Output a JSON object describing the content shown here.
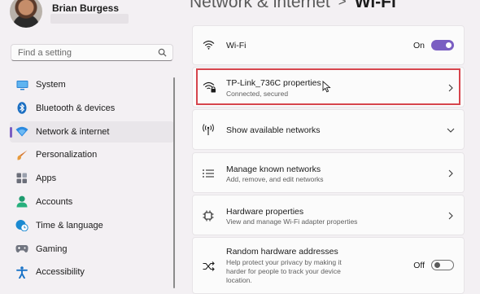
{
  "user": {
    "name": "Brian Burgess"
  },
  "search": {
    "placeholder": "Find a setting"
  },
  "sidebar": {
    "items": [
      {
        "label": "System",
        "icon": "monitor-icon"
      },
      {
        "label": "Bluetooth & devices",
        "icon": "bluetooth-icon"
      },
      {
        "label": "Network & internet",
        "icon": "wifi-icon",
        "active": true
      },
      {
        "label": "Personalization",
        "icon": "paintbrush-icon"
      },
      {
        "label": "Apps",
        "icon": "apps-icon"
      },
      {
        "label": "Accounts",
        "icon": "person-icon"
      },
      {
        "label": "Time & language",
        "icon": "globe-clock-icon"
      },
      {
        "label": "Gaming",
        "icon": "gamepad-icon"
      },
      {
        "label": "Accessibility",
        "icon": "accessibility-icon"
      }
    ]
  },
  "header": {
    "breadcrumb_parent": "Network & internet",
    "separator": ">",
    "current": "Wi-Fi"
  },
  "main": {
    "wifi": {
      "label": "Wi-Fi",
      "state": "On",
      "enabled": true
    },
    "network": {
      "label": "TP-Link_736C properties",
      "status": "Connected, secured"
    },
    "show_available": {
      "label": "Show available networks"
    },
    "manage_known": {
      "label": "Manage known networks",
      "desc": "Add, remove, and edit networks"
    },
    "hardware": {
      "label": "Hardware properties",
      "desc": "View and manage Wi-Fi adapter properties"
    },
    "random_hw": {
      "label": "Random hardware addresses",
      "desc": "Help protect your privacy by making it harder for people to track your device location.",
      "state": "Off",
      "enabled": false
    }
  },
  "colors": {
    "accent": "#7a5ec2",
    "highlight": "#d6454d"
  }
}
